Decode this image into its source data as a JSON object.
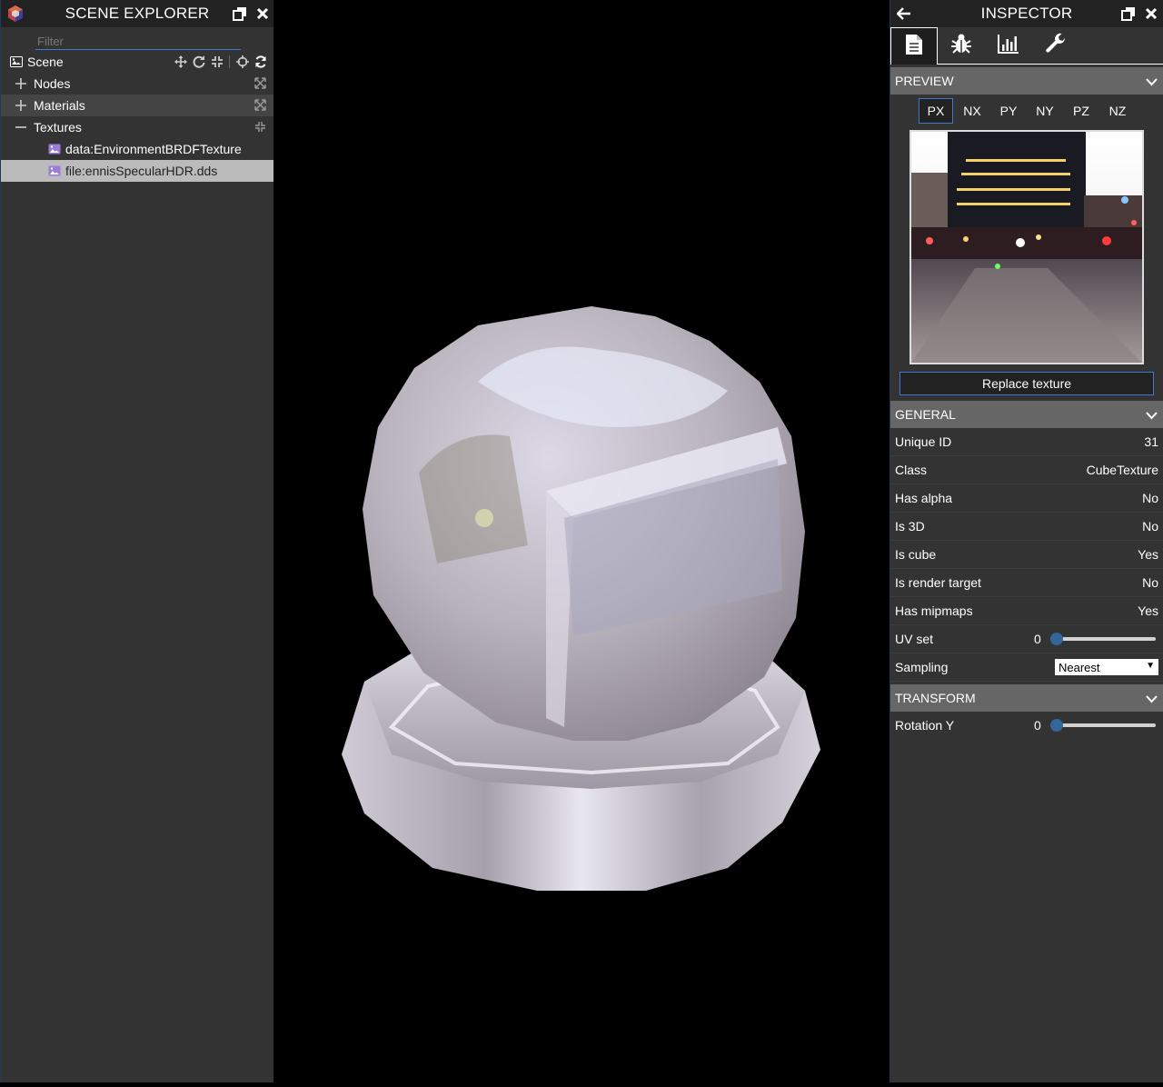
{
  "explorer": {
    "title": "SCENE EXPLORER",
    "filter_placeholder": "Filter",
    "scene_label": "Scene",
    "tree": [
      {
        "label": "Nodes",
        "expander": "plus"
      },
      {
        "label": "Materials",
        "expander": "plus"
      },
      {
        "label": "Textures",
        "expander": "minus"
      },
      {
        "label": "data:EnvironmentBRDFTexture"
      },
      {
        "label": "file:ennisSpecularHDR.dds"
      }
    ]
  },
  "inspector": {
    "title": "INSPECTOR",
    "tabs": [
      "document-icon",
      "bug-icon",
      "chart-icon",
      "wrench-icon"
    ],
    "preview": {
      "heading": "PREVIEW",
      "faces": [
        "PX",
        "NX",
        "PY",
        "NY",
        "PZ",
        "NZ"
      ],
      "active_face": "PX",
      "replace_label": "Replace texture"
    },
    "general": {
      "heading": "GENERAL",
      "rows": [
        {
          "label": "Unique ID",
          "value": "31"
        },
        {
          "label": "Class",
          "value": "CubeTexture"
        },
        {
          "label": "Has alpha",
          "value": "No"
        },
        {
          "label": "Is 3D",
          "value": "No"
        },
        {
          "label": "Is cube",
          "value": "Yes"
        },
        {
          "label": "Is render target",
          "value": "No"
        },
        {
          "label": "Has mipmaps",
          "value": "Yes"
        }
      ],
      "uv_set": {
        "label": "UV set",
        "value": "0"
      },
      "sampling": {
        "label": "Sampling",
        "value": "Nearest"
      }
    },
    "transform": {
      "heading": "TRANSFORM",
      "rotation_y": {
        "label": "Rotation Y",
        "value": "0"
      }
    }
  },
  "colors": {
    "accent": "#3c7ad1",
    "panel": "#333333",
    "header": "#222222",
    "section": "#666666",
    "slider_knob": "#336699"
  }
}
